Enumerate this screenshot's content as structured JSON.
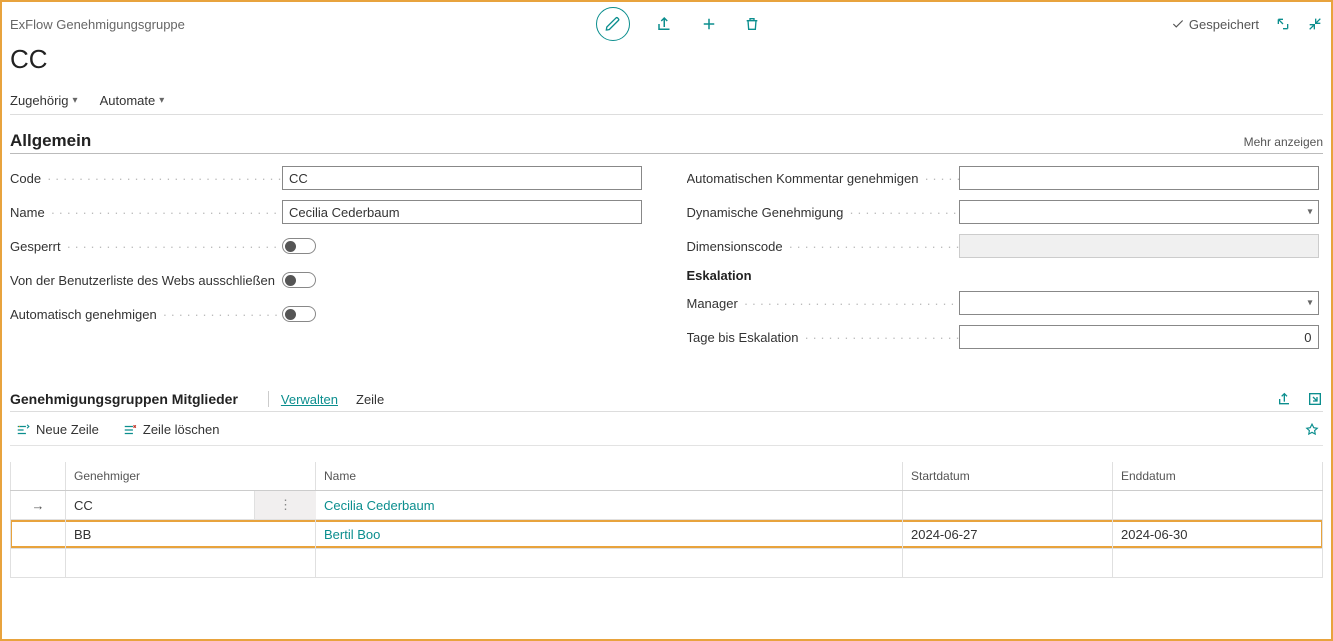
{
  "breadcrumb": "ExFlow Genehmigungsgruppe",
  "title": "CC",
  "saved_label": "Gespeichert",
  "nav": {
    "related": "Zugehörig",
    "automate": "Automate"
  },
  "section_general": {
    "title": "Allgemein",
    "show_more": "Mehr anzeigen",
    "labels": {
      "code": "Code",
      "name": "Name",
      "blocked": "Gesperrt",
      "exclude_web": "Von der Benutzerliste des Webs ausschließen",
      "auto_approve": "Automatisch genehmigen",
      "auto_comment": "Automatischen Kommentar genehmigen",
      "dyn_approval": "Dynamische Genehmigung",
      "dim_code": "Dimensionscode",
      "escalation": "Eskalation",
      "manager": "Manager",
      "days_escalation": "Tage bis Eskalation"
    },
    "values": {
      "code": "CC",
      "name": "Cecilia Cederbaum",
      "auto_comment": "",
      "dyn_approval": "",
      "dim_code": "",
      "manager": "",
      "days_escalation": "0"
    }
  },
  "members": {
    "title": "Genehmigungsgruppen Mitglieder",
    "manage": "Verwalten",
    "line": "Zeile",
    "new_line": "Neue Zeile",
    "delete_line": "Zeile löschen",
    "columns": {
      "approver": "Genehmiger",
      "name": "Name",
      "start": "Startdatum",
      "end": "Enddatum"
    },
    "rows": [
      {
        "approver": "CC",
        "name": "Cecilia Cederbaum",
        "start": "",
        "end": ""
      },
      {
        "approver": "BB",
        "name": "Bertil Boo",
        "start": "2024-06-27",
        "end": "2024-06-30"
      }
    ]
  }
}
